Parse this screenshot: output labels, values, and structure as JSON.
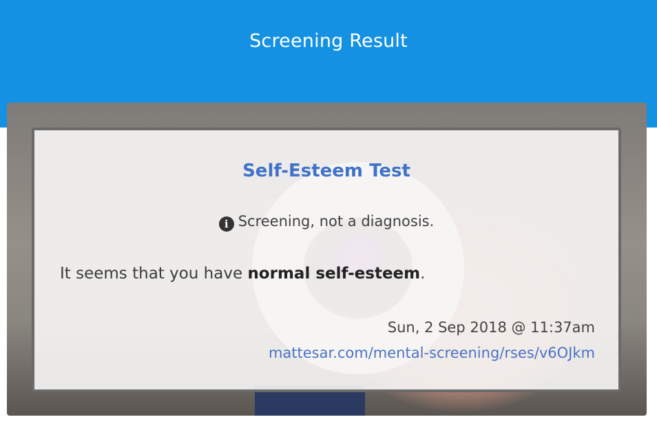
{
  "header": {
    "title": "Screening Result"
  },
  "card": {
    "title": "Self-Esteem Test",
    "disclaimer_icon": "info-circle-icon",
    "disclaimer": "Screening, not a diagnosis.",
    "result_prefix": "It seems that you have ",
    "result_emphasis": "normal self-esteem",
    "result_suffix": ".",
    "timestamp": "Sun, 2 Sep 2018 @ 11:37am",
    "link": "mattesar.com/mental-screening/rses/v6OJkm"
  },
  "colors": {
    "header_bg": "#1591e3",
    "title": "#3f72c8",
    "link": "#4a72c4"
  }
}
